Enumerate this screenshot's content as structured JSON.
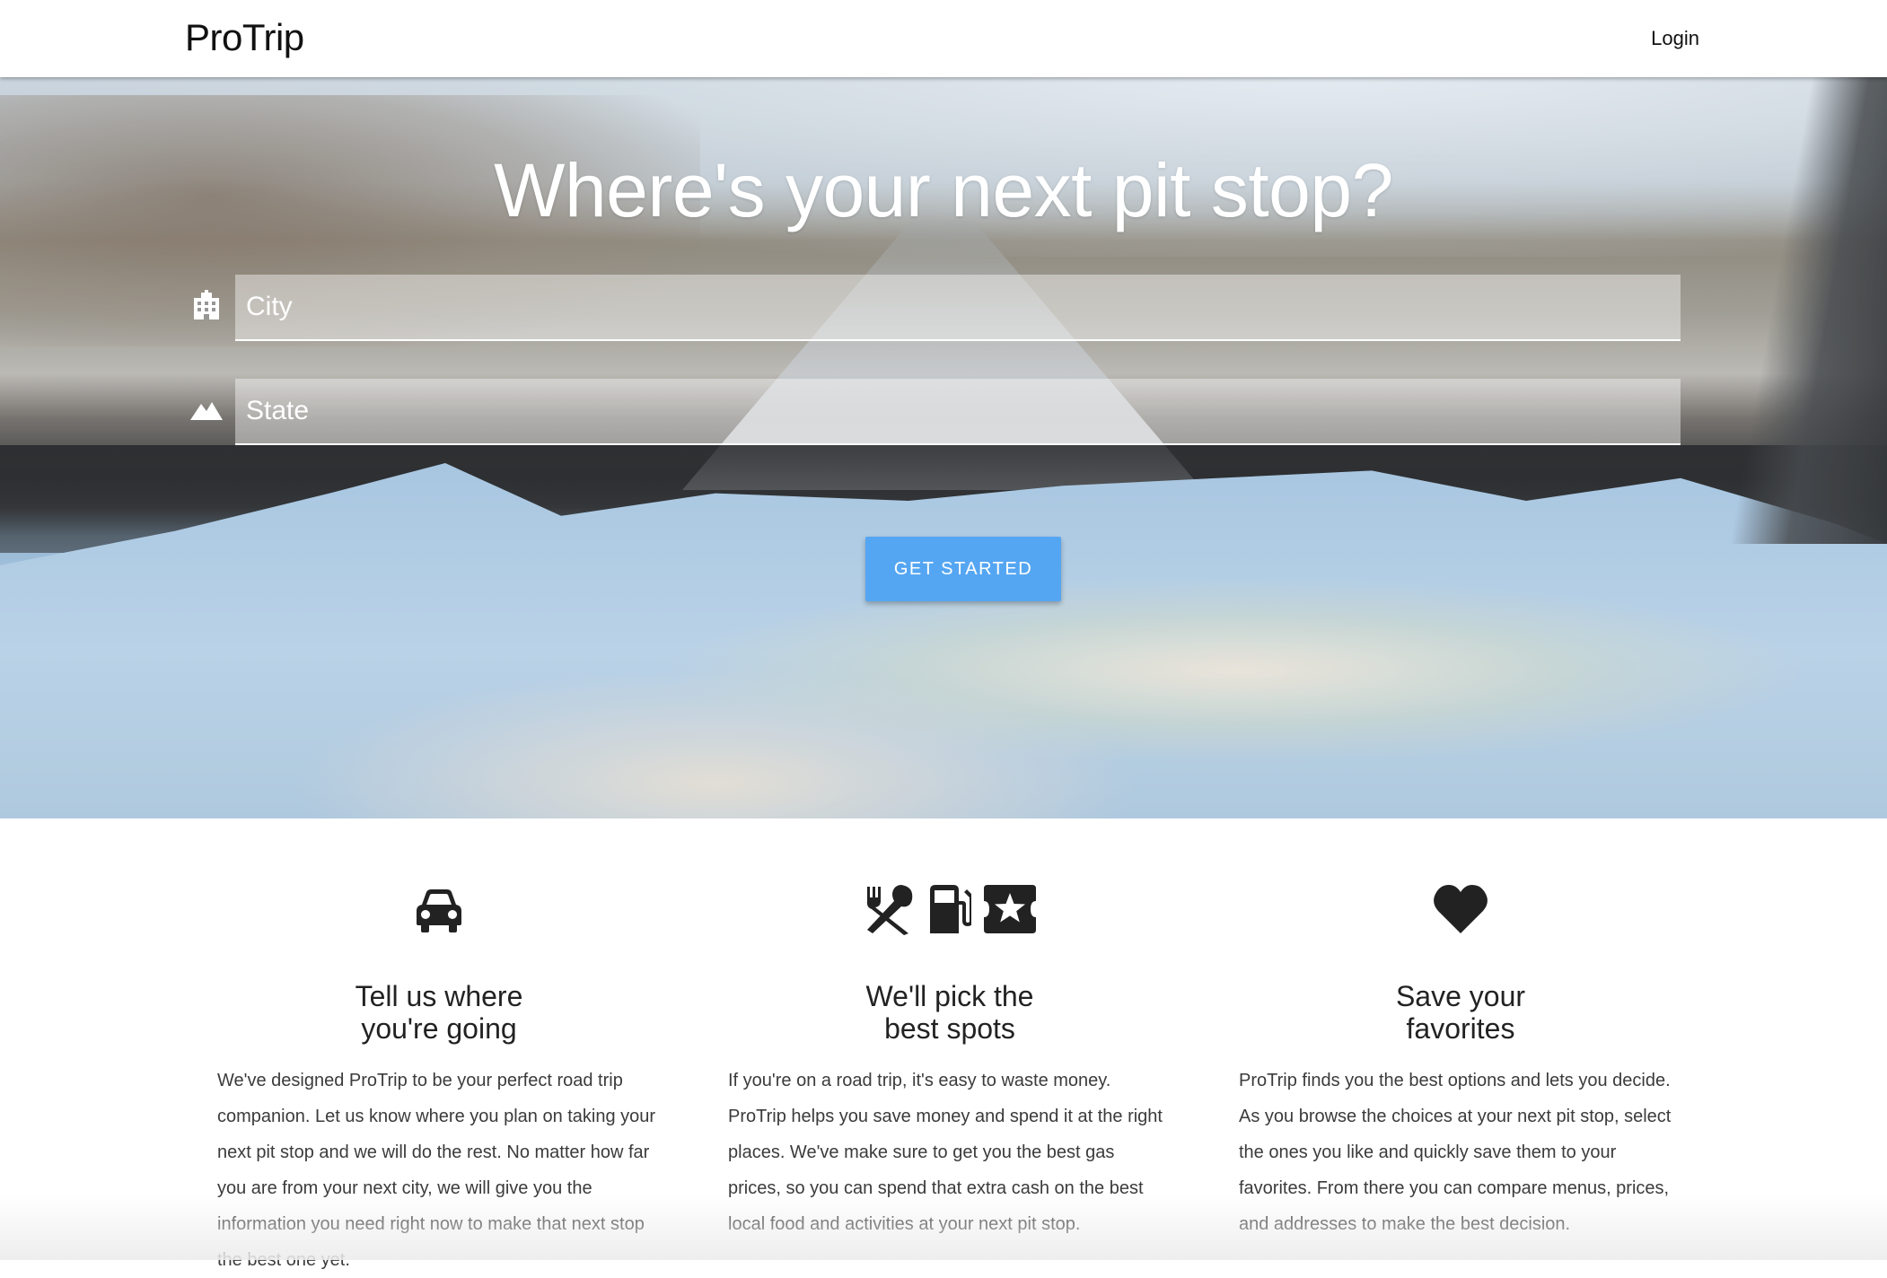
{
  "navbar": {
    "brand": "ProTrip",
    "login_label": "Login"
  },
  "hero": {
    "title": "Where's your next pit stop?",
    "city": {
      "placeholder": "City",
      "value": "",
      "icon": "city-icon"
    },
    "state": {
      "placeholder": "State",
      "value": "",
      "icon": "mountain-icon"
    },
    "cta_label": "GET STARTED"
  },
  "features": [
    {
      "icons": [
        "car-icon"
      ],
      "title_line1": "Tell us where",
      "title_line2": "you're going",
      "body": "We've designed ProTrip to be your perfect road trip companion. Let us know where you plan on taking your next pit stop and we will do the rest. No matter how far you are from your next city, we will give you the information you need right now to make that next stop the best one yet."
    },
    {
      "icons": [
        "restaurant-icon",
        "gas-station-icon",
        "ticket-star-icon"
      ],
      "title_line1": "We'll pick the",
      "title_line2": "best spots",
      "body": "If you're on a road trip, it's easy to waste money. ProTrip helps you save money and spend it at the right places. We've make sure to get you the best gas prices, so you can spend that extra cash on the best local food and activities at your next pit stop."
    },
    {
      "icons": [
        "heart-icon"
      ],
      "title_line1": "Save your",
      "title_line2": "favorites",
      "body": "ProTrip finds you the best options and lets you decide. As you browse the choices at your next pit stop, select the ones you like and quickly save them to your favorites. From there you can compare menus, prices, and addresses to make the best decision."
    }
  ],
  "colors": {
    "accent": "#55a6f2",
    "icon": "#222222"
  }
}
